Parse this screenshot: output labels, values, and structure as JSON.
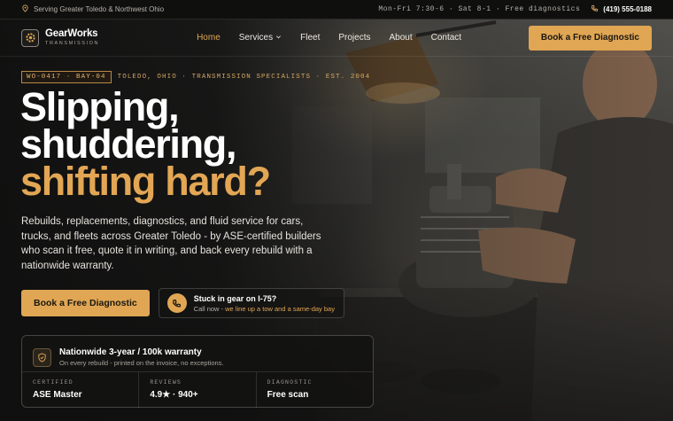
{
  "topbar": {
    "location": "Serving Greater Toledo & Northwest Ohio",
    "hours": "Mon-Fri 7:30-6 · Sat 8-1 · Free diagnostics",
    "phone": "(419) 555-0188"
  },
  "nav": {
    "brand_name": "GearWorks",
    "brand_sub": "TRANSMISSION",
    "items": [
      "Home",
      "Services",
      "Fleet",
      "Projects",
      "About",
      "Contact"
    ],
    "active_item": "Home",
    "cta": "Book a Free Diagnostic"
  },
  "hero": {
    "work_order": "WO-0417 · BAY-04",
    "tagline": "TOLEDO, OHIO · TRANSMISSION SPECIALISTS · EST. 2004",
    "headline_line1": "Slipping,",
    "headline_line2": "shuddering,",
    "headline_line3": "shifting hard?",
    "lede": "Rebuilds, replacements, diagnostics, and fluid service for cars, trucks, and fleets across Greater Toledo - by ASE-certified builders who scan it free, quote it in writing, and back every rebuild with a nationwide warranty.",
    "primary_cta": "Book a Free Diagnostic",
    "stuck_title": "Stuck in gear on I-75?",
    "stuck_sub_lead": "Call now - ",
    "stuck_sub_highlight": "we line up a tow and a same-day bay"
  },
  "warranty": {
    "title": "Nationwide 3-year / 100k warranty",
    "subtitle": "On every rebuild - printed on the invoice, no exceptions.",
    "stats": [
      {
        "label": "CERTIFIED",
        "value": "ASE Master"
      },
      {
        "label": "REVIEWS",
        "value": "4.9★ · 940+"
      },
      {
        "label": "DIAGNOSTIC",
        "value": "Free scan"
      }
    ]
  },
  "colors": {
    "accent": "#e0a653",
    "background": "#141414"
  },
  "icons": [
    "location-pin-icon",
    "phone-icon",
    "gear-logo-icon",
    "chevron-down-icon",
    "shield-icon"
  ]
}
